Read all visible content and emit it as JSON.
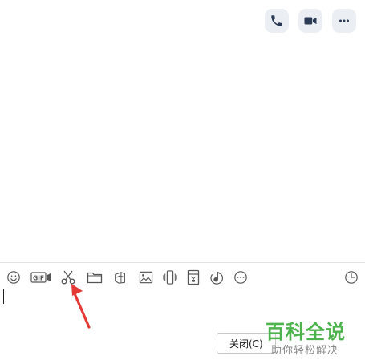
{
  "header": {
    "call_icon": "phone-icon",
    "video_icon": "video-camera-icon",
    "more_icon": "more-horizontal-icon"
  },
  "toolbar": {
    "icons": [
      "emoji-icon",
      "gif-icon",
      "scissors-icon",
      "folder-icon",
      "image-collage-icon",
      "image-icon",
      "shake-window-icon",
      "red-packet-icon",
      "music-icon",
      "more-options-icon",
      "history-clock-icon"
    ],
    "gif_text": "GIF"
  },
  "actions": {
    "close_label": "关闭(C)"
  },
  "watermark": {
    "title": "百科全说",
    "subtitle": "助你轻松解决"
  },
  "colors": {
    "accent_bg": "#ebeff4",
    "icon_gray": "#555555",
    "arrow_red": "#e53935",
    "watermark_green": "#4db34d"
  }
}
